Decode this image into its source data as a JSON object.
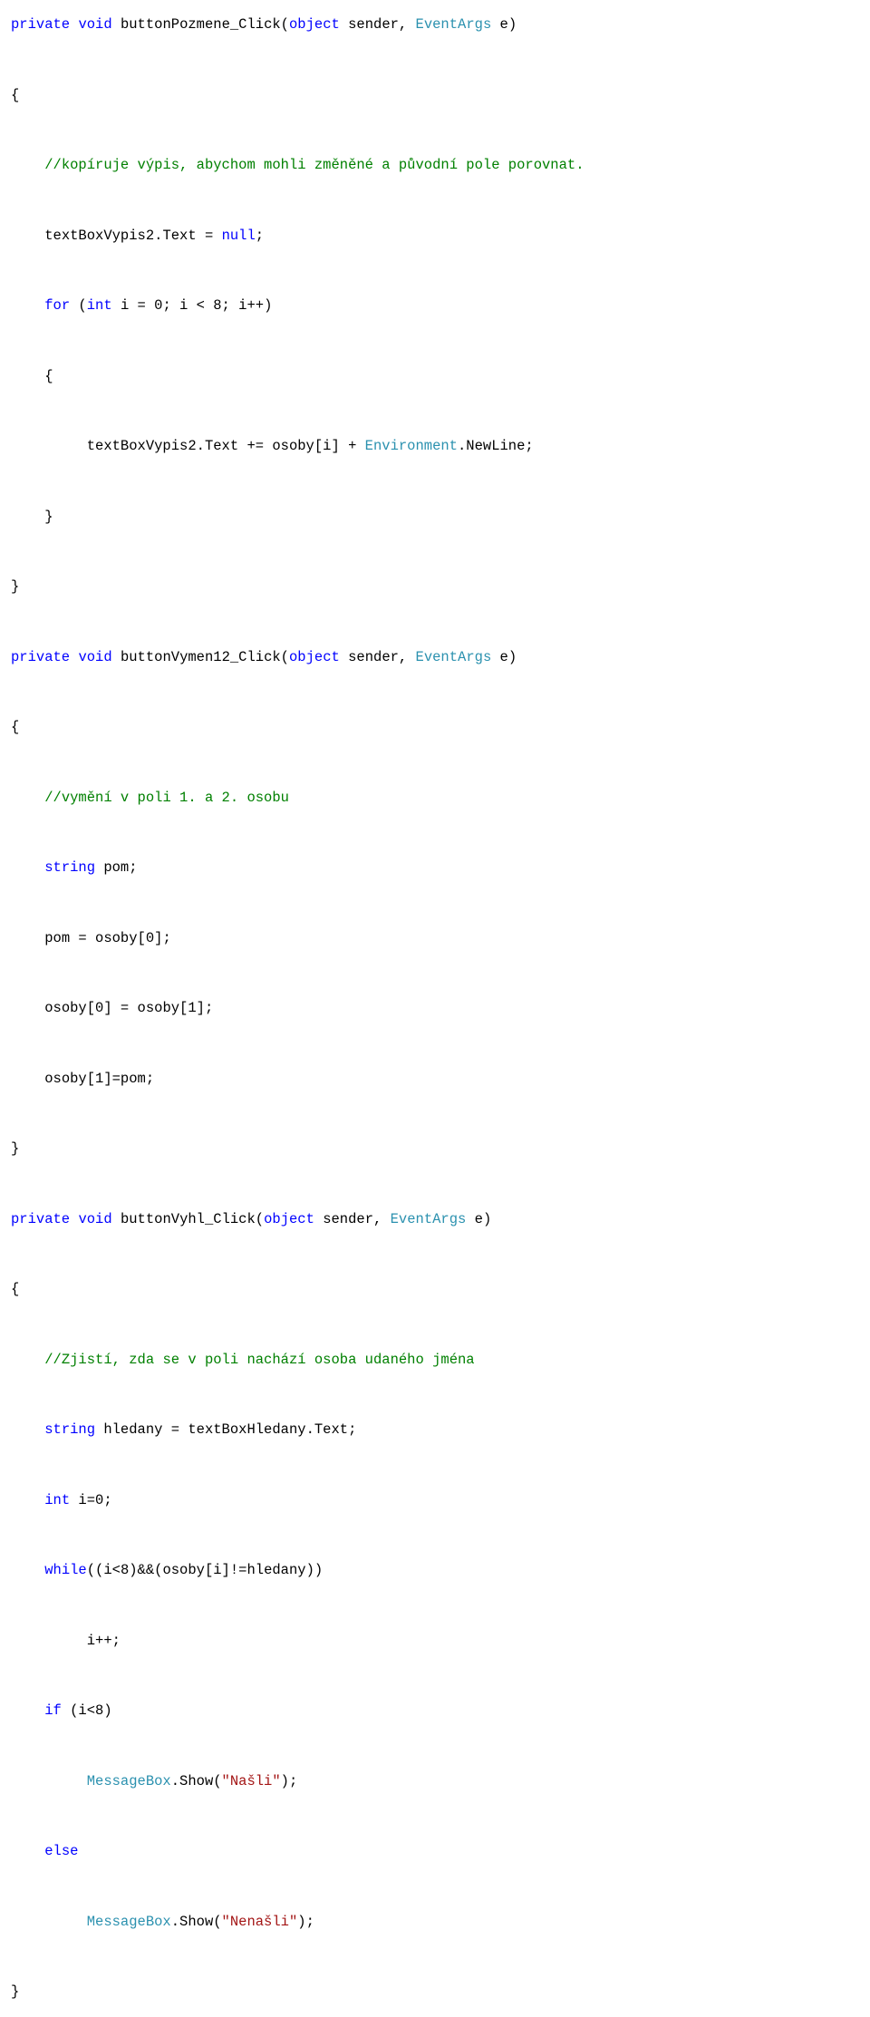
{
  "code": {
    "h1": "<span class=\"kw\">private</span> <span class=\"kw\">void</span> buttonPozmene_Click(<span class=\"kw\">object</span> sender, <span class=\"type\">EventArgs</span> e)",
    "o1": "{",
    "c1": "<span class=\"cm\">//kopíruje výpis, abychom mohli změněné a původní pole porovnat.</span>",
    "l1": "textBoxVypis2.Text = <span class=\"kw\">null</span>;",
    "l2": "<span class=\"kw\">for</span> (<span class=\"kw\">int</span> i = 0; i &lt; 8; i++)",
    "o2": "{",
    "l3": "textBoxVypis2.Text += osoby[i] + <span class=\"type\">Environment</span>.NewLine;",
    "c2": "}",
    "c3": "}",
    "h2": "<span class=\"kw\">private</span> <span class=\"kw\">void</span> buttonVymen12_Click(<span class=\"kw\">object</span> sender, <span class=\"type\">EventArgs</span> e)",
    "o3": "{",
    "cm2": "<span class=\"cm\">//vymění v poli 1. a 2. osobu</span>",
    "l4": "<span class=\"kw\">string</span> pom;",
    "l5": "pom = osoby[0];",
    "l6": "osoby[0] = osoby[1];",
    "l7": "osoby[1]=pom;",
    "c4": "}",
    "h3": "<span class=\"kw\">private</span> <span class=\"kw\">void</span> buttonVyhl_Click(<span class=\"kw\">object</span> sender, <span class=\"type\">EventArgs</span> e)",
    "o4": "{",
    "cm3": "<span class=\"cm\">//Zjistí, zda se v poli nachází osoba udaného jména</span>",
    "l8": "<span class=\"kw\">string</span> hledany = textBoxHledany.Text;",
    "l9": "<span class=\"kw\">int</span> i=0;",
    "l10": "<span class=\"kw\">while</span>((i&lt;8)&amp;&amp;(osoby[i]!=hledany))",
    "l11": "i++;",
    "l12": "<span class=\"kw\">if</span> (i&lt;8)",
    "l13": "<span class=\"type\">MessageBox</span>.Show(<span class=\"str\">\"Našli\"</span>);",
    "l14": "<span class=\"kw\">else</span>",
    "l15": "<span class=\"type\">MessageBox</span>.Show(<span class=\"str\">\"Nenašli\"</span>);",
    "c5": "}"
  }
}
